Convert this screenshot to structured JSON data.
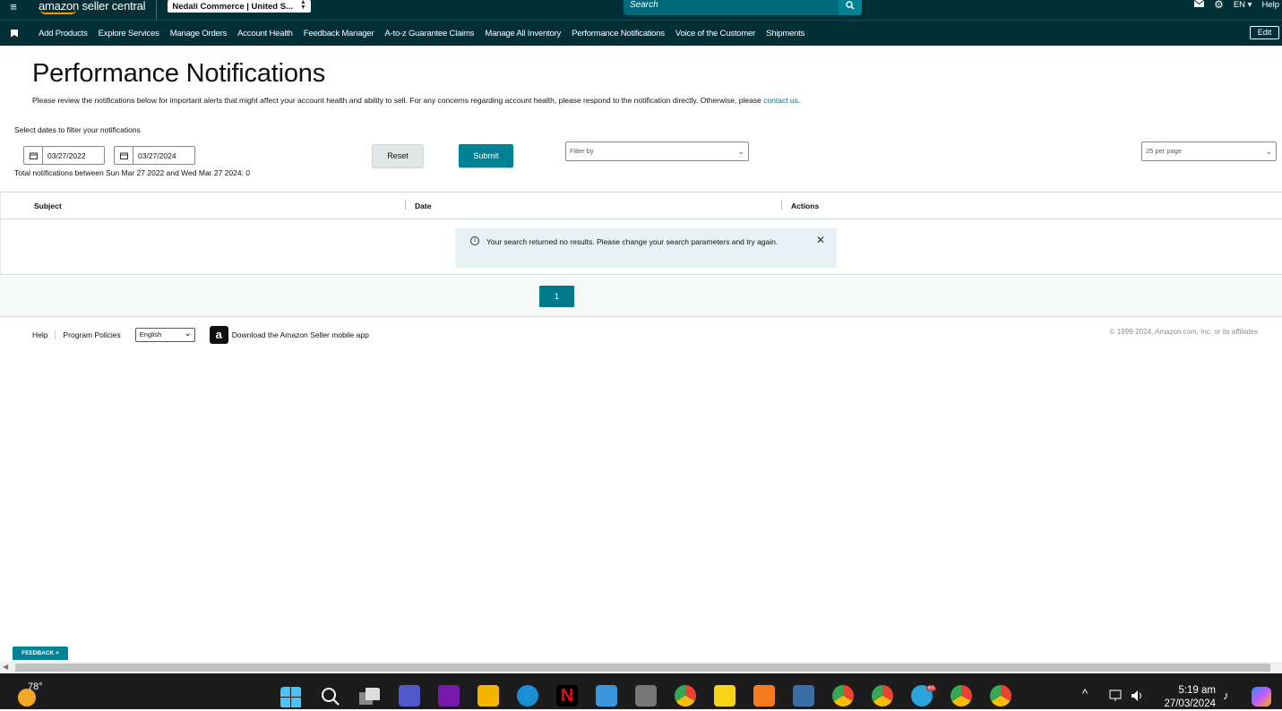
{
  "header": {
    "logo": "amazon seller central",
    "account": "Nedali Commerce | United S...",
    "search_placeholder": "Search",
    "language": "EN ▾",
    "help": "Help"
  },
  "nav": {
    "items": [
      "Add Products",
      "Explore Services",
      "Manage Orders",
      "Account Health",
      "Feedback Manager",
      "A-to-z Guarantee Claims",
      "Manage All Inventory",
      "Performance Notifications",
      "Voice of the Customer",
      "Shipments"
    ],
    "edit": "Edit"
  },
  "page": {
    "title": "Performance Notifications",
    "desc": "Please review the notifications below for important alerts that might affect your account health and ability to sell. For any concerns regarding account health, please respond to the notification directly. Otherwise, please ",
    "contact": "contact us.",
    "filter_label": "Select dates to filter your notifications",
    "date_from": "03/27/2022",
    "date_to": "03/27/2024",
    "total": "Total notifications between Sun Mar 27 2022 and Wed Mar 27 2024: 0",
    "reset": "Reset",
    "submit": "Submit",
    "filter_by": "Filter by",
    "per_page": "25 per page"
  },
  "table": {
    "columns": [
      "Subject",
      "Date",
      "Actions"
    ],
    "alert": "Your search returned no results. Please change your search parameters and try again.",
    "page": "1"
  },
  "footer": {
    "help": "Help",
    "policies": "Program Policies",
    "language": "English",
    "app": "Download the Amazon Seller mobile app",
    "copyright": "© 1999-2024, Amazon.com, Inc. or its affiliates",
    "feedback": "FEEDBACK ×"
  },
  "taskbar": {
    "temp": "78°",
    "time": "5:19 am",
    "date": "27/03/2024",
    "telegram_badge": "65"
  },
  "colors": {
    "header_bg": "#002f36",
    "accent": "#008296"
  }
}
